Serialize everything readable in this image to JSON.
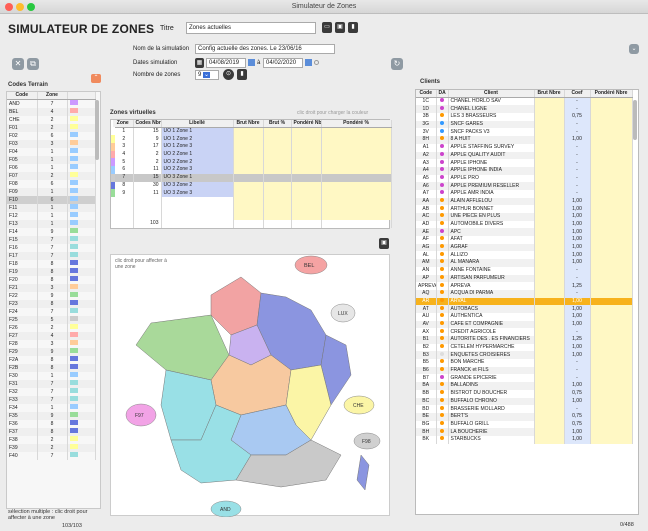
{
  "window": {
    "title": "Simulateur de Zones"
  },
  "header": {
    "app_title": "SIMULATEUR DE ZONES",
    "titre_label": "Titre",
    "titre_value": "Zones actuelles"
  },
  "form": {
    "nom_label": "Nom de la simulation",
    "nom_value": "Config actuelle des zones. Le 23/06/16",
    "dates_label": "Dates simulation",
    "date_from": "04/08/2019",
    "date_sep": "à",
    "date_to": "04/02/2020",
    "nb_label": "Nombre de zones",
    "nb_value": "9"
  },
  "codes_terrain": {
    "title": "Codes Terrain",
    "headers": [
      "Code",
      "Zone"
    ],
    "rows": [
      [
        "AND",
        "7",
        "#cc99ff"
      ],
      [
        "BEL",
        "4",
        "#ffaaaa"
      ],
      [
        "CHE",
        "2",
        "#ffff99"
      ],
      [
        "F01",
        "2",
        "#ffff99"
      ],
      [
        "F02",
        "6",
        "#99ccff"
      ],
      [
        "F03",
        "3",
        "#ffcc99"
      ],
      [
        "F04",
        "1",
        "#99ccff"
      ],
      [
        "F05",
        "1",
        "#99ccff"
      ],
      [
        "F06",
        "1",
        "#99ccff"
      ],
      [
        "F07",
        "2",
        "#ffff99"
      ],
      [
        "F08",
        "6",
        "#99ccff"
      ],
      [
        "F09",
        "1",
        "#99ccff"
      ],
      [
        "F10",
        "6",
        "#99ccff"
      ],
      [
        "F11",
        "1",
        "#99ccff"
      ],
      [
        "F12",
        "1",
        "#99ccff"
      ],
      [
        "F13",
        "1",
        "#99ccff"
      ],
      [
        "F14",
        "9",
        "#99dd99"
      ],
      [
        "F15",
        "7",
        "#99dddd"
      ],
      [
        "F16",
        "7",
        "#99dddd"
      ],
      [
        "F17",
        "7",
        "#99dddd"
      ],
      [
        "F18",
        "8",
        "#6677dd"
      ],
      [
        "F19",
        "8",
        "#6677dd"
      ],
      [
        "F20",
        "8",
        "#6677dd"
      ],
      [
        "F21",
        "3",
        "#ffcc99"
      ],
      [
        "F22",
        "9",
        "#99dd99"
      ],
      [
        "F23",
        "8",
        "#6677dd"
      ],
      [
        "F24",
        "7",
        "#99dddd"
      ],
      [
        "F25",
        "5",
        "#cccccc"
      ],
      [
        "F26",
        "2",
        "#ffff99"
      ],
      [
        "F27",
        "4",
        "#ffaaaa"
      ],
      [
        "F28",
        "3",
        "#ffcc99"
      ],
      [
        "F29",
        "9",
        "#99dd99"
      ],
      [
        "F2A",
        "8",
        "#6677dd"
      ],
      [
        "F2B",
        "8",
        "#6677dd"
      ],
      [
        "F30",
        "1",
        "#99ccff"
      ],
      [
        "F31",
        "7",
        "#99dddd"
      ],
      [
        "F32",
        "7",
        "#99dddd"
      ],
      [
        "F33",
        "7",
        "#99dddd"
      ],
      [
        "F34",
        "1",
        "#99ccff"
      ],
      [
        "F35",
        "9",
        "#99dd99"
      ],
      [
        "F36",
        "8",
        "#6677dd"
      ],
      [
        "F37",
        "8",
        "#6677dd"
      ],
      [
        "F38",
        "2",
        "#ffff99"
      ],
      [
        "F39",
        "2",
        "#ffff99"
      ],
      [
        "F40",
        "7",
        "#99dddd"
      ]
    ],
    "foot_note": "sélection multiple : clic droit pour affecter à une zone",
    "count": "103/103"
  },
  "zones_virtuelles": {
    "title": "Zones virtuelles",
    "hint": "clic droit pour charger la couleur",
    "headers": [
      "Zone",
      "Codes Nbre",
      "Libellé",
      "Brut Nbre",
      "Brut %",
      "Pondéré Nbre",
      "Pondéré %"
    ],
    "rows": [
      [
        "1",
        "15",
        "UO 1 Zone 1",
        "#ffffff"
      ],
      [
        "2",
        "9",
        "UO 1 Zone 2",
        "#ffff99"
      ],
      [
        "3",
        "17",
        "UO 1 Zone 3",
        "#ffcc99"
      ],
      [
        "4",
        "2",
        "UO 2 Zone 1",
        "#ffaaaa"
      ],
      [
        "5",
        "2",
        "UO 2 Zone 2",
        "#cc99ff"
      ],
      [
        "6",
        "11",
        "UO 2 Zone 3",
        "#99ccff"
      ],
      [
        "7",
        "15",
        "UO 3 Zone 1",
        "#cccccc"
      ],
      [
        "8",
        "30",
        "UO 3 Zone 2",
        "#6677dd"
      ],
      [
        "9",
        "11",
        "UO 3 Zone 3",
        "#99dd99"
      ]
    ],
    "total": "103"
  },
  "map": {
    "hint": "clic droit pour affecter à une zone",
    "labels": {
      "bel": "BEL",
      "lux": "LUX",
      "che": "CHE",
      "f97": "F97",
      "f98": "F98",
      "and": "AND"
    }
  },
  "clients": {
    "title": "Clients",
    "headers": [
      "Code",
      "DA",
      "Client",
      "Brut Nbre",
      "Coef",
      "Pondéré Nbre"
    ],
    "rows": [
      [
        "1C",
        "#cc44cc",
        "CHANEL HORLO SAV",
        "",
        "-",
        ""
      ],
      [
        "1D",
        "#cc44cc",
        "CHANEL LIGNE",
        "",
        "-",
        ""
      ],
      [
        "3B",
        "#ff9900",
        "LES 3 BRASSEURS",
        "",
        "0,75",
        ""
      ],
      [
        "3G",
        "#3399ff",
        "SNCF GARES",
        "",
        "-",
        ""
      ],
      [
        "3V",
        "#3399ff",
        "SNCF PACKS V3",
        "",
        "-",
        ""
      ],
      [
        "8H",
        "#ff9900",
        "8 A HUIT",
        "",
        "1,00",
        ""
      ],
      [
        "A1",
        "#cc44cc",
        "APPLE STAFFING SURVEY",
        "",
        "-",
        ""
      ],
      [
        "A2",
        "#cc44cc",
        "APPLE QUALITY AUDIT",
        "",
        "-",
        ""
      ],
      [
        "A3",
        "#cc44cc",
        "APPLE IPHONE",
        "",
        "-",
        ""
      ],
      [
        "A4",
        "#cc44cc",
        "APPLE IPHONE INDIA",
        "",
        "-",
        ""
      ],
      [
        "A5",
        "#cc44cc",
        "APPLE PRO",
        "",
        "-",
        ""
      ],
      [
        "A6",
        "#cc44cc",
        "APPLE PREMIUM RESELLER",
        "",
        "-",
        ""
      ],
      [
        "A7",
        "#cc44cc",
        "APPLE AMR INDIA",
        "",
        "-",
        ""
      ],
      [
        "AA",
        "#ff9900",
        "ALAIN AFFLELOU",
        "",
        "1,00",
        ""
      ],
      [
        "AB",
        "#ff9900",
        "ARTHUR BONNET",
        "",
        "1,00",
        ""
      ],
      [
        "AC",
        "#ff9900",
        "UNE PIECE EN PLUS",
        "",
        "1,00",
        ""
      ],
      [
        "AD",
        "#ff9900",
        "AUTOMOBILE DIVERS",
        "",
        "1,00",
        ""
      ],
      [
        "AE",
        "#cc44cc",
        "APC",
        "",
        "1,00",
        ""
      ],
      [
        "AF",
        "#ff9900",
        "AFAT",
        "",
        "1,00",
        ""
      ],
      [
        "AG",
        "#ff9900",
        "AGRAF",
        "",
        "1,00",
        ""
      ],
      [
        "AL",
        "#ff9900",
        "ALLIZO",
        "",
        "1,00",
        ""
      ],
      [
        "AM",
        "#ff9900",
        "AL MANARA",
        "",
        "1,00",
        ""
      ],
      [
        "AN",
        "#ff9900",
        "ANNE FONTAINE",
        "",
        "-",
        ""
      ],
      [
        "AP",
        "#ff9900",
        "ARTISAN PARFUMEUR",
        "",
        "-",
        ""
      ],
      [
        "APREVA",
        "#ff9900",
        "APREVA",
        "",
        "1,25",
        ""
      ],
      [
        "AQ",
        "#ff9900",
        "ACQUA DI PARMA",
        "",
        "-",
        ""
      ],
      [
        "AR",
        "#ff9900",
        "ARVAL",
        "",
        "1,00",
        "",
        "sel"
      ],
      [
        "AT",
        "#ff9900",
        "AUTOBACS",
        "",
        "1,00",
        ""
      ],
      [
        "AU",
        "#ff9900",
        "AUTHENTICA",
        "",
        "1,00",
        ""
      ],
      [
        "AV",
        "#ff9900",
        "CAFE ET COMPAGNIE",
        "",
        "1,00",
        ""
      ],
      [
        "AX",
        "#ff9900",
        "CREDIT AGRICOLE",
        "",
        "-",
        ""
      ],
      [
        "B1",
        "#ff9900",
        "AUTORITE DES . ES FINANCIERS",
        "",
        "1,25",
        ""
      ],
      [
        "B2",
        "#ff9900",
        "CETELEM HYPERMARCHE",
        "",
        "1,00",
        ""
      ],
      [
        "B3",
        "#dddddd",
        "ENQUETES CROISIERES",
        "",
        "1,00",
        ""
      ],
      [
        "B5",
        "#ff9900",
        "BON MARCHE",
        "",
        "-",
        ""
      ],
      [
        "B6",
        "#ff9900",
        "FRANCK et FILS",
        "",
        "-",
        ""
      ],
      [
        "B7",
        "#cc44cc",
        "GRANDE EPICERIE",
        "",
        "-",
        ""
      ],
      [
        "BA",
        "#ff9900",
        "BALLADINS",
        "",
        "1,00",
        ""
      ],
      [
        "BB",
        "#ff9900",
        "BISTROT DU BOUCHER",
        "",
        "0,75",
        ""
      ],
      [
        "BC",
        "#ff9900",
        "BUFFALO CHRONO",
        "",
        "1,00",
        ""
      ],
      [
        "BD",
        "#ff9900",
        "BRASSERIE MOLLARD",
        "",
        "-",
        ""
      ],
      [
        "BE",
        "#ff9900",
        "BERT'S",
        "",
        "0,75",
        ""
      ],
      [
        "BG",
        "#ff9900",
        "BUFFALO GRILL",
        "",
        "0,75",
        ""
      ],
      [
        "BH",
        "#ff9900",
        "LA BOUCHERIE",
        "",
        "1,00",
        ""
      ],
      [
        "BK",
        "#ff9900",
        "STARBUCKS",
        "",
        "1,00",
        ""
      ]
    ],
    "count": "0/488"
  }
}
